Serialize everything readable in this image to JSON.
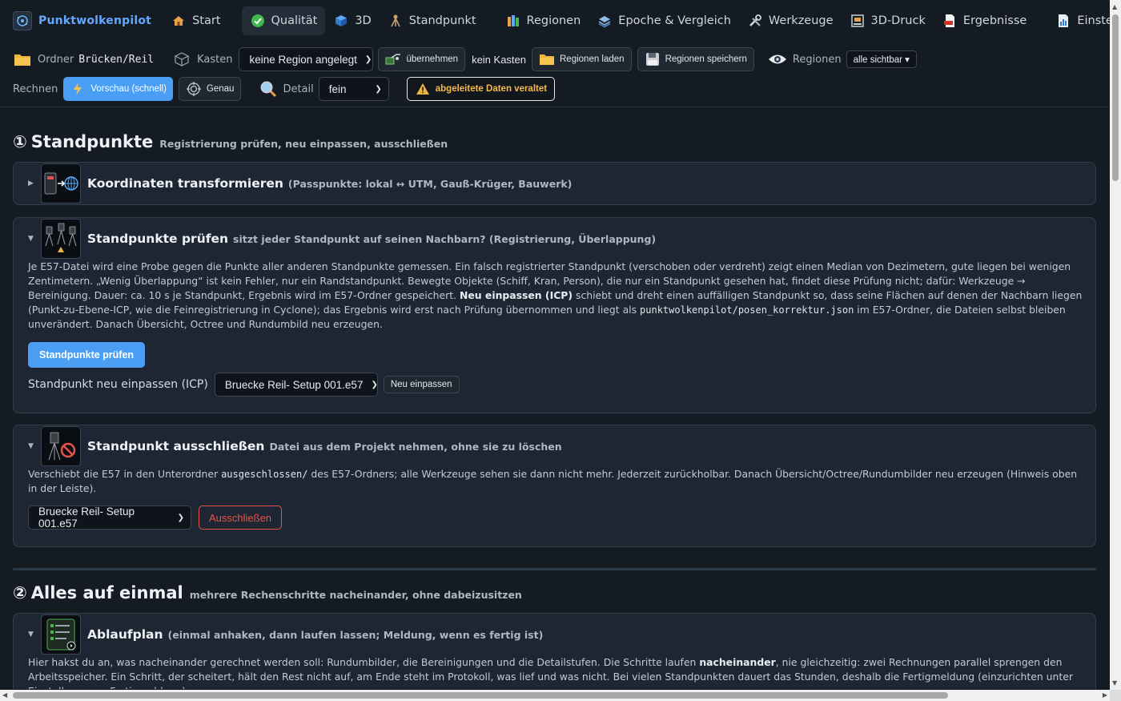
{
  "app": {
    "name": "Punktwolkenpilot"
  },
  "nav": {
    "tabs": [
      {
        "label": "Start",
        "icon": "house-icon"
      },
      {
        "label": "Qualität",
        "icon": "check-circle-icon",
        "active": true
      },
      {
        "label": "3D",
        "icon": "cube-icon"
      },
      {
        "label": "Standpunkt",
        "icon": "tripod-icon"
      },
      {
        "label": "Regionen",
        "icon": "books-icon"
      },
      {
        "label": "Epoche & Vergleich",
        "icon": "layers-icon"
      },
      {
        "label": "Werkzeuge",
        "icon": "tools-icon"
      },
      {
        "label": "3D-Druck",
        "icon": "printer-icon"
      },
      {
        "label": "Ergebnisse",
        "icon": "pdf-icon"
      },
      {
        "label": "Einstellungen",
        "icon": "chart-doc-icon"
      }
    ]
  },
  "toolbar": {
    "folder_label": "Ordner",
    "folder_value": "Brücken/Reil",
    "box_label": "Kasten",
    "region_select": "keine Region angelegt",
    "adopt_label": "übernehmen",
    "no_box": "kein Kasten",
    "load_regions": "Regionen laden",
    "save_regions": "Regionen speichern",
    "regions_label": "Regionen",
    "regions_visibility": "alle sichtbar ▾",
    "compute_label": "Rechnen",
    "preview_label": "Vorschau (schnell)",
    "exact_label": "Genau",
    "detail_label": "Detail",
    "detail_value": "fein",
    "stale_warning": "abgeleitete Daten veraltet"
  },
  "section1": {
    "number": "①",
    "title": "Standpunkte",
    "subtitle": "Registrierung prüfen, neu einpassen, ausschließen"
  },
  "card_transform": {
    "title": "Koordinaten transformieren",
    "subtitle": "(Passpunkte: lokal ↔ UTM, Gauß-Krüger, Bauwerk)"
  },
  "card_check": {
    "title": "Standpunkte prüfen",
    "subtitle": "sitzt jeder Standpunkt auf seinen Nachbarn? (Registrierung, Überlappung)",
    "p_1": "Je E57-Datei wird eine Probe gegen die Punkte aller anderen Standpunkte gemessen. Ein falsch registrierter Standpunkt (verschoben oder verdreht) zeigt einen Median von Dezimetern, gute liegen bei wenigen Zentimetern. „Wenig Überlappung“ ist kein Fehler, nur ein Randstandpunkt. Bewegte Objekte (Schiff, Kran, Person), die nur ein Standpunkt gesehen hat, findet diese Prüfung nicht; dafür: Werkzeuge → Bereinigung. Dauer: ca. 10 s je Standpunkt, Ergebnis wird im E57-Ordner gespeichert.",
    "p_bold": "Neu einpassen (ICP)",
    "p_2": "schiebt und dreht einen auffälligen Standpunkt so, dass seine Flächen auf denen der Nachbarn liegen (Punkt-zu-Ebene-ICP, wie die Feinregistrierung in Cyclone); das Ergebnis wird erst nach Prüfung übernommen und liegt als",
    "p_code": "punktwolkenpilot/posen_korrektur.json",
    "p_3": "im E57-Ordner, die Dateien selbst bleiben unverändert. Danach Übersicht, Octree und Rundumbild neu erzeugen.",
    "button": "Standpunkte prüfen",
    "icp_label": "Standpunkt neu einpassen (ICP)",
    "icp_select": "Bruecke Reil- Setup 001.e57",
    "icp_button": "Neu einpassen"
  },
  "card_exclude": {
    "title": "Standpunkt ausschließen",
    "subtitle": "Datei aus dem Projekt nehmen, ohne sie zu löschen",
    "p_1": "Verschiebt die E57 in den Unterordner",
    "p_code": "ausgeschlossen/",
    "p_2": "des E57-Ordners; alle Werkzeuge sehen sie dann nicht mehr. Jederzeit zurückholbar. Danach Übersicht/Octree/Rundumbilder neu erzeugen (Hinweis oben in der Leiste).",
    "select": "Bruecke Reil- Setup 001.e57",
    "button": "Ausschließen"
  },
  "section2": {
    "number": "②",
    "title": "Alles auf einmal",
    "subtitle": "mehrere Rechenschritte nacheinander, ohne dabeizusitzen"
  },
  "card_plan": {
    "title": "Ablaufplan",
    "subtitle": "(einmal anhaken, dann laufen lassen; Meldung, wenn es fertig ist)",
    "p_1": "Hier hakst du an, was nacheinander gerechnet werden soll: Rundumbilder, die Bereinigungen und die Detailstufen. Die Schritte laufen",
    "p_bold": "nacheinander",
    "p_2": ", nie gleichzeitig: zwei Rechnungen parallel sprengen den Arbeitsspeicher. Ein Schritt, der scheitert, hält den Rest nicht auf, am Ende steht im Protokoll, was lief und was nicht. Bei vielen Standpunkten dauert das Stunden, deshalb die Fertigmeldung (einzurichten unter Einstellungen → Fertigmeldung)."
  },
  "colors": {
    "accent": "#4a9ff5",
    "bg": "#151b23",
    "card": "#1d2632",
    "warn": "#f5b94a",
    "danger": "#e5534b"
  }
}
